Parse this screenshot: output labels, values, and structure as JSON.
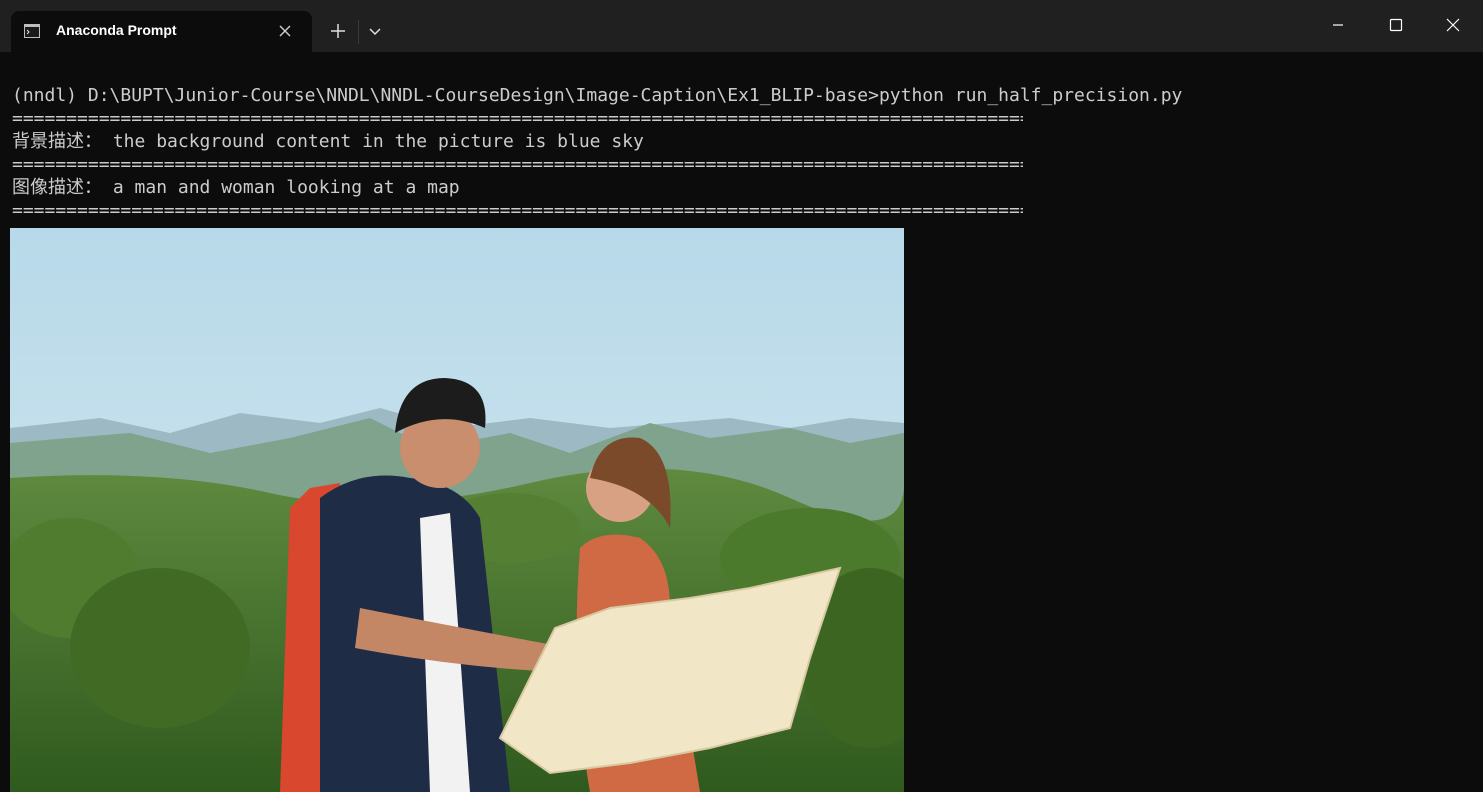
{
  "window": {
    "tab_title": "Anaconda Prompt",
    "tab_icon": "terminal-icon",
    "buttons": [
      "close-tab-icon",
      "plus-icon",
      "chevron-down-icon",
      "minimize-icon",
      "maximize-icon",
      "close-icon"
    ]
  },
  "terminal": {
    "command_line": "(nndl) D:\\BUPT\\Junior-Course\\NNDL\\NNDL-CourseDesign\\Image-Caption\\Ex1_BLIP-base>python run_half_precision.py",
    "separator": "========================================================================================================================",
    "background_label": "背景描述：",
    "background_text": "the background content in the picture is blue sky",
    "image_label": "图像描述：",
    "image_text": "a man and woman looking at a map"
  },
  "colors": {
    "titlebar": "#202020",
    "terminal_bg": "#0c0c0c",
    "terminal_fg": "#cccccc"
  }
}
